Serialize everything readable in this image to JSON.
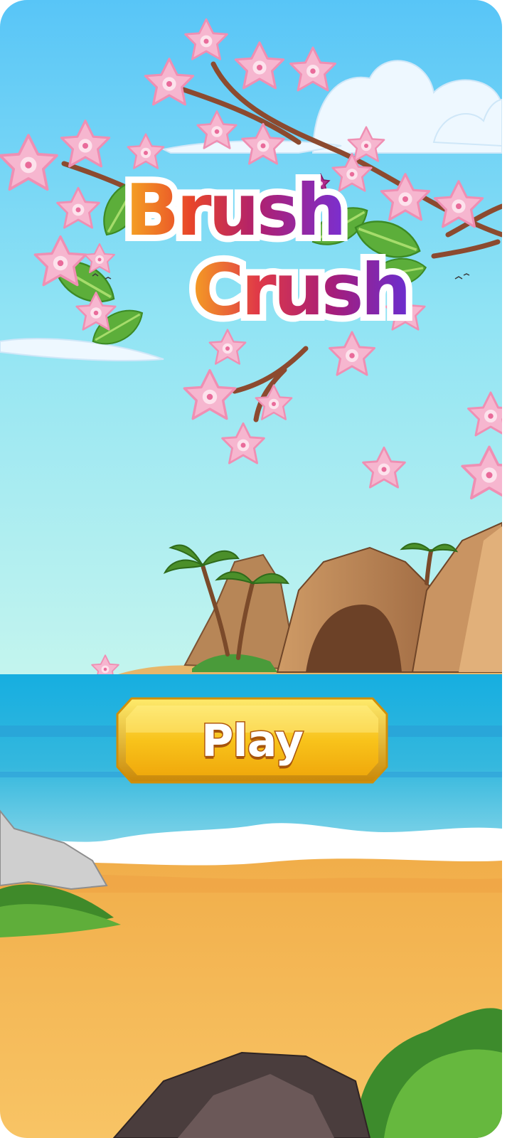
{
  "game": {
    "title_line1": "Brush",
    "title_line2": "Crush",
    "play_label": "Play"
  },
  "colors": {
    "sky_top": "#5fc6f7",
    "sky_bottom": "#b7f3f0",
    "sea": "#1fb3d8",
    "sand": "#f6be60",
    "button_gold": "#f7c01a",
    "title_shadow": "#2b0f57"
  }
}
